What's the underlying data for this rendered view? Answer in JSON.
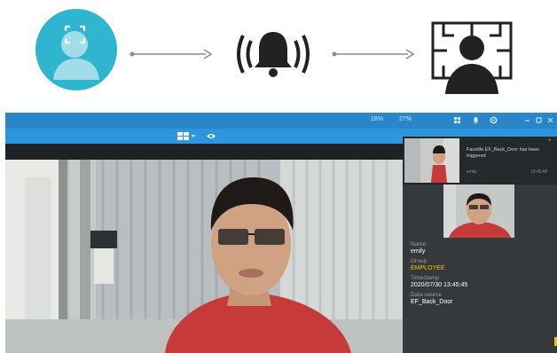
{
  "flow": {
    "steps": [
      {
        "icon": "face-scan-icon"
      },
      {
        "icon": "alarm-bell-icon"
      },
      {
        "icon": "monitor-person-icon"
      }
    ],
    "colors": {
      "face_circle": "#2fb5cf",
      "icon_dark": "#222222",
      "arrow": "#8c8c8c"
    }
  },
  "app": {
    "titlebar": {
      "stat_1": "18%",
      "stat_2": "27%",
      "color": "#2a86c9"
    },
    "toolbar_color": "#2d96dc",
    "alert": {
      "message": "Facelife EF_Back_Door has been triggered",
      "source_name": "emily",
      "time": "13:45:45",
      "close_label": "×"
    },
    "details": {
      "name_label": "Name",
      "name_value": "emily",
      "group_label": "Group",
      "group_value": "EMPLOYEE",
      "timestamp_label": "Timestamp",
      "timestamp_value": "2020/07/30 13:45:45",
      "source_label": "Data source",
      "source_value": "EF_Back_Door"
    },
    "accent_group_color": "#f2c200"
  }
}
